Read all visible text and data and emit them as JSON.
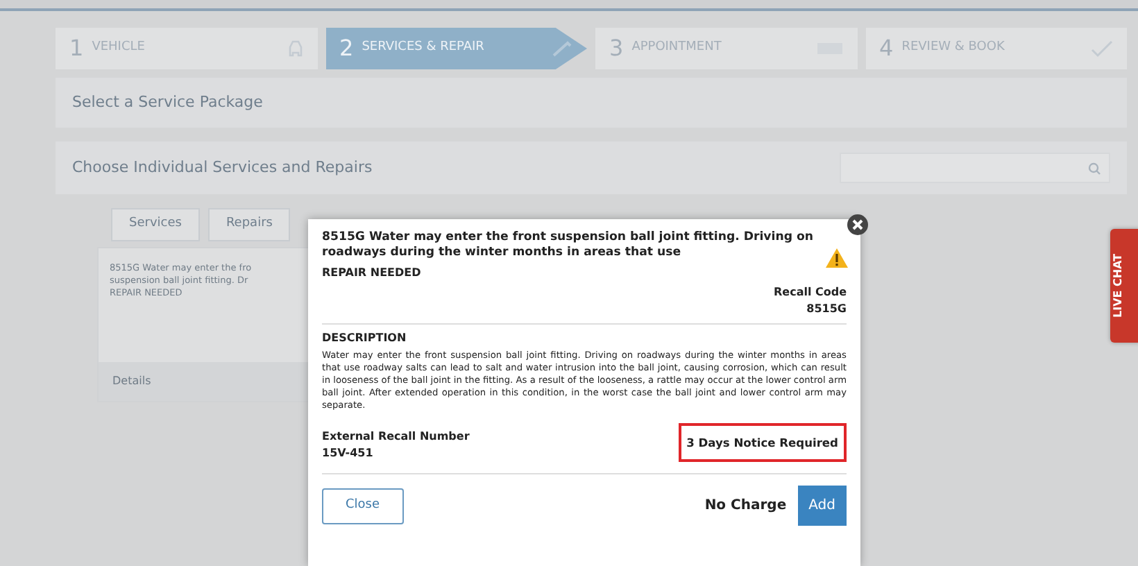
{
  "steps": [
    {
      "number": "1",
      "label": "VEHICLE",
      "selected": false
    },
    {
      "number": "2",
      "label": "SERVICES & REPAIR",
      "selected": true
    },
    {
      "number": "3",
      "label": "APPOINTMENT",
      "selected": false
    },
    {
      "number": "4",
      "label": "REVIEW & BOOK",
      "selected": false
    }
  ],
  "package_panel": {
    "title": "Select a Service Package"
  },
  "individual_panel": {
    "title": "Choose Individual Services and Repairs"
  },
  "service_tabs": [
    {
      "label": "Services",
      "selected": false
    },
    {
      "label": "Repairs",
      "selected": false
    }
  ],
  "service_card": {
    "lines": [
      "8515G Water may enter the fro",
      "suspension ball joint fitting. Dr",
      "REPAIR NEEDED"
    ],
    "footer": "Details"
  },
  "modal": {
    "title": "8515G Water may enter the front suspension ball joint fitting. Driving on roadways during the winter months in areas that use",
    "status": "REPAIR NEEDED",
    "recall_code_label": "Recall Code",
    "recall_code": "8515G",
    "description_heading": "DESCRIPTION",
    "description": "Water may enter the front suspension ball joint fitting. Driving on roadways during the winter months in areas that use roadway salts can lead to salt and water intrusion into the ball joint, causing corrosion, which can result in looseness of the ball joint in the fitting. As a result of the looseness, a rattle may occur at the lower control arm ball joint. After extended operation in this condition, in the worst case the ball joint and lower control arm may separate.",
    "external_label": "External Recall Number",
    "external_number": "15V-451",
    "notice": "3 Days Notice Required",
    "close_button": "Close",
    "price": "No Charge",
    "add_button": "Add"
  },
  "live_chat": "LIVE CHAT"
}
